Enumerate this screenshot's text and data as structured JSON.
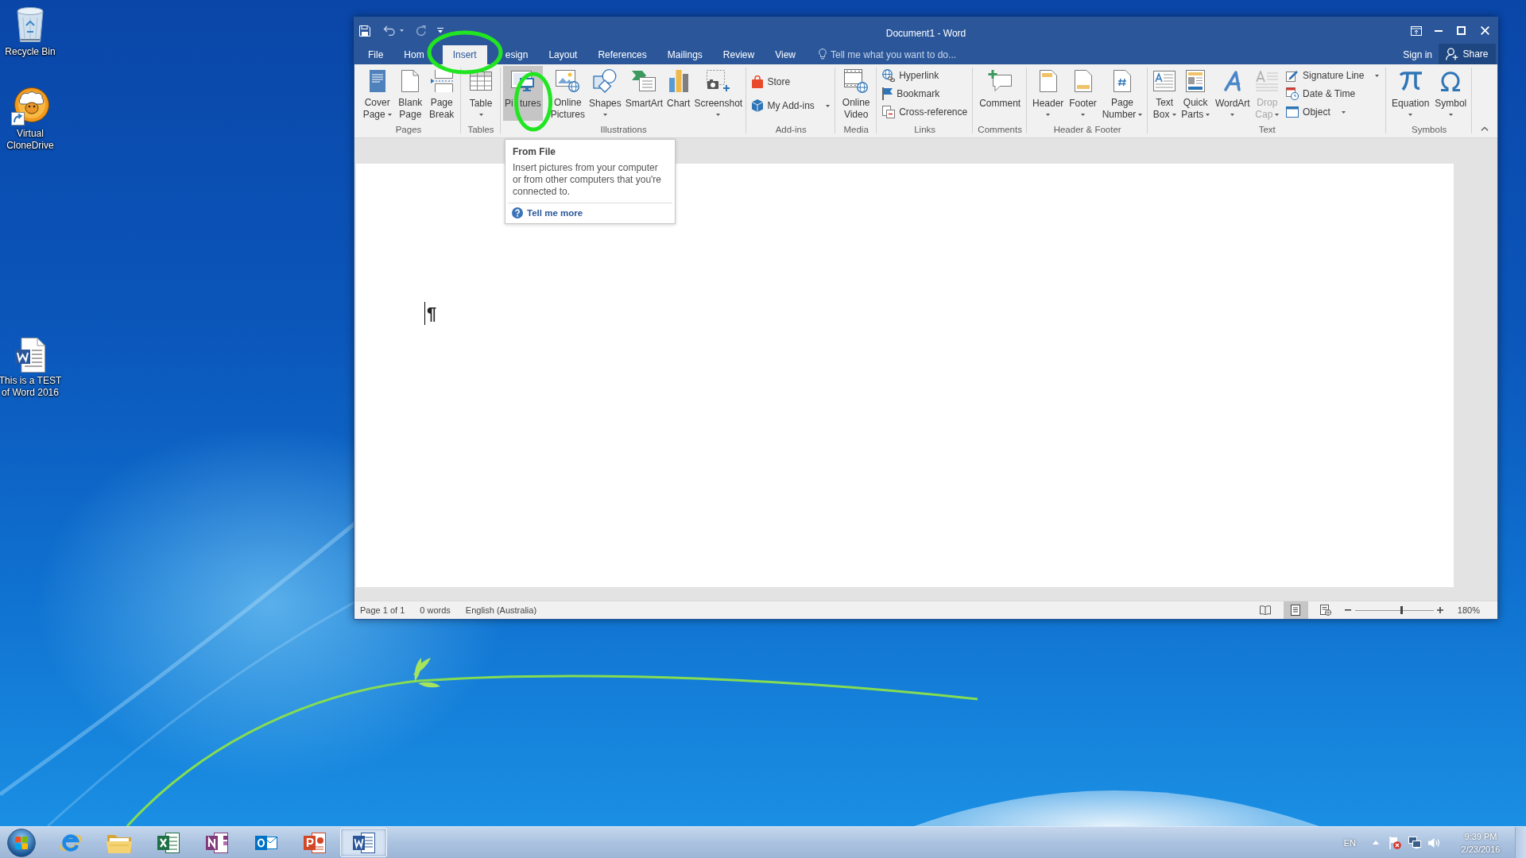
{
  "desktop_icons": [
    {
      "label": "Recycle Bin"
    },
    {
      "label": "Virtual\nCloneDrive"
    },
    {
      "label": "This is a TEST\nof Word 2016"
    }
  ],
  "window": {
    "title": "Document1 - Word",
    "sign_in": "Sign in",
    "share": "Share"
  },
  "tabs": [
    {
      "label": "File",
      "selected": false,
      "circled": false
    },
    {
      "label": "Hom",
      "selected": false,
      "circled": false
    },
    {
      "label": "Insert",
      "selected": true,
      "circled": true
    },
    {
      "label": "esign",
      "selected": false,
      "circled": false
    },
    {
      "label": "Layout",
      "selected": false,
      "circled": false
    },
    {
      "label": "References",
      "selected": false,
      "circled": false
    },
    {
      "label": "Mailings",
      "selected": false,
      "circled": false
    },
    {
      "label": "Review",
      "selected": false,
      "circled": false
    },
    {
      "label": "View",
      "selected": false,
      "circled": false
    }
  ],
  "tell_me": {
    "placeholder": "Tell me what you want to do..."
  },
  "ribbon": {
    "groups": [
      {
        "label": "Pages",
        "buttons": [
          {
            "kind": "large",
            "label": "Cover\nPage",
            "dropdown": true,
            "hovered": false,
            "circled": false,
            "disabled": false
          },
          {
            "kind": "large",
            "label": "Blank\nPage",
            "dropdown": false,
            "hovered": false,
            "circled": false,
            "disabled": false
          },
          {
            "kind": "large",
            "label": "Page\nBreak",
            "dropdown": false,
            "hovered": false,
            "circled": false,
            "disabled": false
          }
        ]
      },
      {
        "label": "Tables",
        "buttons": [
          {
            "kind": "large",
            "label": "Table",
            "dropdown": true,
            "hovered": false,
            "circled": false,
            "disabled": false
          }
        ]
      },
      {
        "label": "Illustrations",
        "buttons": [
          {
            "kind": "large",
            "label": "Pi tures",
            "dropdown": false,
            "hovered": true,
            "circled": true,
            "disabled": false
          },
          {
            "kind": "large",
            "label": "Online\nPictures",
            "dropdown": false,
            "hovered": false,
            "circled": false,
            "disabled": false
          },
          {
            "kind": "large",
            "label": "Shapes",
            "dropdown": true,
            "hovered": false,
            "circled": false,
            "disabled": false
          },
          {
            "kind": "large",
            "label": "SmartArt",
            "dropdown": false,
            "hovered": false,
            "circled": false,
            "disabled": false
          },
          {
            "kind": "large",
            "label": "Chart",
            "dropdown": false,
            "hovered": false,
            "circled": false,
            "disabled": false
          },
          {
            "kind": "large",
            "label": "Screenshot",
            "dropdown": true,
            "hovered": false,
            "circled": false,
            "disabled": false
          }
        ]
      },
      {
        "label": "Add-ins",
        "buttons": [
          {
            "kind": "small",
            "label": "Store",
            "dropdown": false,
            "hovered": false,
            "circled": false,
            "disabled": false
          },
          {
            "kind": "small",
            "label": "My Add-ins",
            "dropdown": true,
            "hovered": false,
            "circled": false,
            "disabled": false
          }
        ]
      },
      {
        "label": "Media",
        "buttons": [
          {
            "kind": "large",
            "label": "Online\nVideo",
            "dropdown": false,
            "hovered": false,
            "circled": false,
            "disabled": false
          }
        ]
      },
      {
        "label": "Links",
        "buttons": [
          {
            "kind": "small",
            "label": "Hyperlink",
            "dropdown": false,
            "hovered": false,
            "circled": false,
            "disabled": false
          },
          {
            "kind": "small",
            "label": "Bookmark",
            "dropdown": false,
            "hovered": false,
            "circled": false,
            "disabled": false
          },
          {
            "kind": "small",
            "label": "Cross-reference",
            "dropdown": false,
            "hovered": false,
            "circled": false,
            "disabled": false
          }
        ]
      },
      {
        "label": "Comments",
        "buttons": [
          {
            "kind": "large",
            "label": "Comment",
            "dropdown": false,
            "hovered": false,
            "circled": false,
            "disabled": false
          }
        ]
      },
      {
        "label": "Header & Footer",
        "buttons": [
          {
            "kind": "large",
            "label": "Header",
            "dropdown": true,
            "hovered": false,
            "circled": false,
            "disabled": false
          },
          {
            "kind": "large",
            "label": "Footer",
            "dropdown": true,
            "hovered": false,
            "circled": false,
            "disabled": false
          },
          {
            "kind": "large",
            "label": "Page\nNumber",
            "dropdown": true,
            "hovered": false,
            "circled": false,
            "disabled": false
          }
        ]
      },
      {
        "label": "Text",
        "buttons": [
          {
            "kind": "large",
            "label": "Text\nBox",
            "dropdown": true,
            "hovered": false,
            "circled": false,
            "disabled": false
          },
          {
            "kind": "large",
            "label": "Quick\nParts",
            "dropdown": true,
            "hovered": false,
            "circled": false,
            "disabled": false
          },
          {
            "kind": "large",
            "label": "WordArt",
            "dropdown": true,
            "hovered": false,
            "circled": false,
            "disabled": false
          },
          {
            "kind": "large",
            "label": "Drop\nCap",
            "dropdown": true,
            "hovered": false,
            "circled": false,
            "disabled": true
          },
          {
            "kind": "small",
            "label": "Signature Line",
            "dropdown": true,
            "hovered": false,
            "circled": false,
            "disabled": false
          },
          {
            "kind": "small",
            "label": "Date & Time",
            "dropdown": false,
            "hovered": false,
            "circled": false,
            "disabled": false
          },
          {
            "kind": "small",
            "label": "Object",
            "dropdown": true,
            "hovered": false,
            "circled": false,
            "disabled": false
          }
        ]
      },
      {
        "label": "Symbols",
        "buttons": [
          {
            "kind": "large",
            "label": "Equation",
            "dropdown": true,
            "hovered": false,
            "circled": false,
            "disabled": false
          },
          {
            "kind": "large",
            "label": "Symbol",
            "dropdown": true,
            "hovered": false,
            "circled": false,
            "disabled": false
          }
        ]
      }
    ]
  },
  "tooltip": {
    "title": "From File",
    "text": "Insert pictures from your computer or from other computers that you're connected to.",
    "link": "Tell me more"
  },
  "document": {
    "paragraph_mark": "¶"
  },
  "status_bar": {
    "page": "Page 1 of 1",
    "words": "0 words",
    "language": "English (Australia)",
    "views": [
      {
        "selected": false
      },
      {
        "selected": true
      },
      {
        "selected": false
      }
    ],
    "zoom": {
      "level": 0.59,
      "reading": "180%"
    }
  },
  "taskbar": {
    "apps": [
      {
        "selected": false
      },
      {
        "selected": false
      },
      {
        "selected": false
      },
      {
        "selected": false
      },
      {
        "selected": false
      },
      {
        "selected": false
      },
      {
        "selected": true
      }
    ],
    "language": "EN",
    "time": "9:39 PM",
    "date": "2/23/2016"
  }
}
